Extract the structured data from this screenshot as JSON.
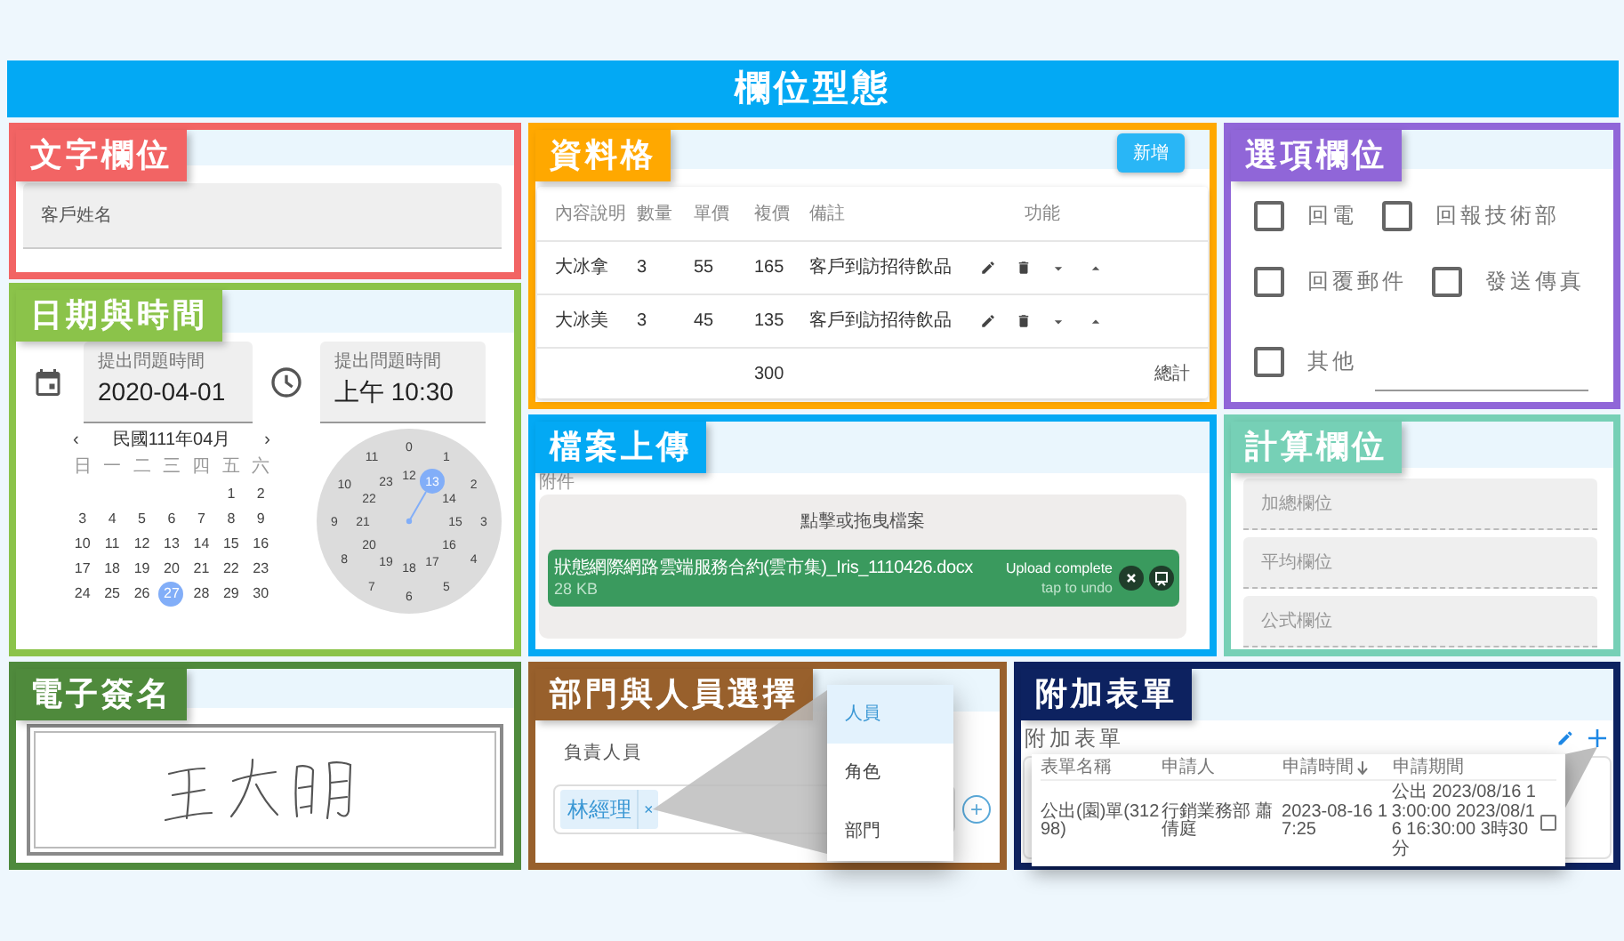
{
  "page_title": "欄位型態",
  "panels": [
    {
      "kind": "text",
      "title": "文字欄位",
      "color": "#f26464",
      "field": {
        "placeholder": "客戶姓名"
      }
    },
    {
      "kind": "datetime",
      "title": "日期與時間",
      "color": "#8bc34a",
      "date_field": {
        "label": "提出問題時間",
        "value": "2020-04-01"
      },
      "time_field": {
        "label": "提出問題時間",
        "value": "上午 10:30"
      },
      "calendar": {
        "prev": "‹",
        "month": "民國111年04月",
        "next": "›",
        "weekdays": [
          "日",
          "一",
          "二",
          "三",
          "四",
          "五",
          "六"
        ],
        "weeks": [
          [
            {
              "text": "1",
              "selected": false
            },
            {
              "text": "2",
              "selected": false
            }
          ],
          [
            {
              "text": "3",
              "selected": false
            },
            {
              "text": "4",
              "selected": false
            },
            {
              "text": "5",
              "selected": false
            },
            {
              "text": "6",
              "selected": false
            },
            {
              "text": "7",
              "selected": false
            },
            {
              "text": "8",
              "selected": false
            },
            {
              "text": "9",
              "selected": false
            }
          ],
          [
            {
              "text": "10",
              "selected": false
            },
            {
              "text": "11",
              "selected": false
            },
            {
              "text": "12",
              "selected": false
            },
            {
              "text": "13",
              "selected": false
            },
            {
              "text": "14",
              "selected": false
            },
            {
              "text": "15",
              "selected": false
            },
            {
              "text": "16",
              "selected": false
            }
          ],
          [
            {
              "text": "17",
              "selected": false
            },
            {
              "text": "18",
              "selected": false
            },
            {
              "text": "19",
              "selected": false
            },
            {
              "text": "20",
              "selected": false
            },
            {
              "text": "21",
              "selected": false
            },
            {
              "text": "22",
              "selected": false
            },
            {
              "text": "23",
              "selected": false
            }
          ],
          [
            {
              "text": "24",
              "selected": false
            },
            {
              "text": "25",
              "selected": false
            },
            {
              "text": "26",
              "selected": false
            },
            {
              "text": "27",
              "selected": true
            },
            {
              "text": "28",
              "selected": false
            },
            {
              "text": "29",
              "selected": false
            },
            {
              "text": "30",
              "selected": false
            }
          ]
        ]
      },
      "clock": {
        "outer": [
          {
            "text": "0",
            "selected": false
          },
          {
            "text": "1",
            "selected": false
          },
          {
            "text": "2",
            "selected": false
          },
          {
            "text": "3",
            "selected": false
          },
          {
            "text": "4",
            "selected": false
          },
          {
            "text": "5",
            "selected": false
          },
          {
            "text": "6",
            "selected": false
          },
          {
            "text": "7",
            "selected": false
          },
          {
            "text": "8",
            "selected": false
          },
          {
            "text": "9",
            "selected": false
          },
          {
            "text": "10",
            "selected": false
          },
          {
            "text": "11",
            "selected": false
          }
        ],
        "inner": [
          {
            "text": "12",
            "selected": false
          },
          {
            "text": "13",
            "selected": true
          },
          {
            "text": "14",
            "selected": false
          },
          {
            "text": "15",
            "selected": false
          },
          {
            "text": "16",
            "selected": false
          },
          {
            "text": "17",
            "selected": false
          },
          {
            "text": "18",
            "selected": false
          },
          {
            "text": "19",
            "selected": false
          },
          {
            "text": "20",
            "selected": false
          },
          {
            "text": "21",
            "selected": false
          },
          {
            "text": "22",
            "selected": false
          },
          {
            "text": "23",
            "selected": false
          }
        ]
      }
    },
    {
      "kind": "datatable",
      "title": "資料格",
      "color": "#ffa800",
      "add_button": "新增",
      "columns": [
        "內容說明",
        "數量",
        "單價",
        "複價",
        "備註",
        "功能"
      ],
      "rows": [
        {
          "cells": [
            "大冰拿",
            "3",
            "55",
            "165",
            "客戶到訪招待飲品"
          ]
        },
        {
          "cells": [
            "大冰美",
            "3",
            "45",
            "135",
            "客戶到訪招待飲品"
          ]
        }
      ],
      "total": "300",
      "total_label": "總計"
    },
    {
      "kind": "upload",
      "title": "檔案上傳",
      "color": "#03a9f4",
      "label": "附件",
      "dropzone": "點擊或拖曳檔案",
      "file": {
        "name": "狀態網際網路雲端服務合約(雲市集)_Iris_1110426.docx",
        "size": "28 KB",
        "status": "Upload complete",
        "hint": "tap to undo"
      }
    },
    {
      "kind": "options",
      "title": "選項欄位",
      "color": "#9066d8",
      "items": [
        {
          "kind": "checkbox",
          "label": "回電",
          "checked": false
        },
        {
          "kind": "checkbox",
          "label": "回報技術部",
          "checked": false
        },
        {
          "kind": "checkbox",
          "label": "回覆郵件",
          "checked": false
        },
        {
          "kind": "checkbox",
          "label": "發送傳真",
          "checked": false
        },
        {
          "kind": "other",
          "label": "其他",
          "checked": false
        }
      ]
    },
    {
      "kind": "calc",
      "title": "計算欄位",
      "color": "#76d0b6",
      "fields": [
        {
          "placeholder": "加總欄位"
        },
        {
          "placeholder": "平均欄位"
        },
        {
          "placeholder": "公式欄位"
        }
      ]
    },
    {
      "kind": "signature",
      "title": "電子簽名",
      "color": "#4f8a3c"
    },
    {
      "kind": "people",
      "title": "部門與人員選擇",
      "color": "#98602c",
      "label": "負責人員",
      "chips": [
        {
          "text": "林經理",
          "remove": "×"
        }
      ],
      "add_button": "+",
      "menu": [
        {
          "label": "人員",
          "selected": true
        },
        {
          "label": "角色",
          "selected": false
        },
        {
          "label": "部門",
          "selected": false
        }
      ]
    },
    {
      "kind": "subform",
      "title": "附加表單",
      "color": "#0d2260",
      "heading": "附加表單",
      "columns": [
        {
          "label": "表單名稱",
          "sorted": false
        },
        {
          "label": "申請人",
          "sorted": false
        },
        {
          "label": "申請時間",
          "sorted": true
        },
        {
          "label": "申請期間",
          "sorted": false
        }
      ],
      "rows": [
        {
          "cells": [
            "公出(園)單(31298)",
            "行銷業務部 蕭倩庭",
            "2023-08-16 17:25",
            "公出 2023/08/16 13:00:00 2023/08/16 16:30:00 3時30分"
          ],
          "checked": false
        }
      ]
    }
  ]
}
